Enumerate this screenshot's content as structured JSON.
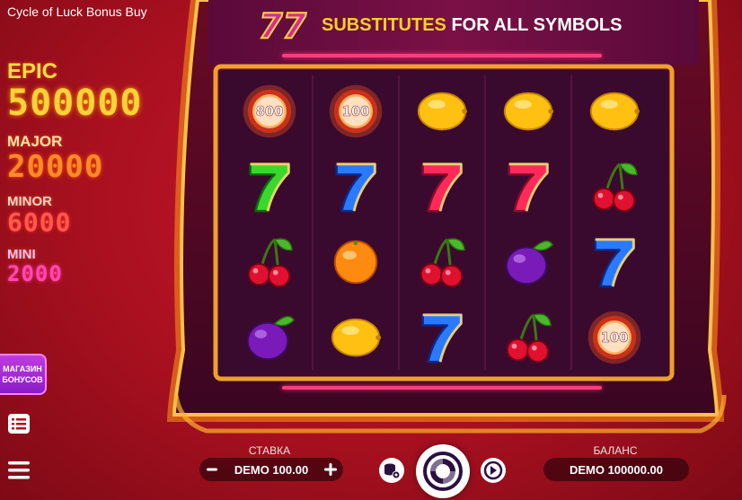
{
  "game_title": "Cycle of Luck Bonus Buy",
  "banner": {
    "highlight": "SUBSTITUTES",
    "rest": " FOR ALL SYMBOLS",
    "wild_symbol": "77"
  },
  "jackpots": {
    "epic": {
      "label": "EPIC",
      "value": "500000"
    },
    "major": {
      "label": "MAJOR",
      "value": "20000"
    },
    "minor": {
      "label": "MINOR",
      "value": "6000"
    },
    "mini": {
      "label": "MINI",
      "value": "2000"
    }
  },
  "bonus_shop": {
    "line1": "МАГАЗИН",
    "line2": "БОНУСОВ"
  },
  "grid": [
    [
      {
        "type": "coin",
        "value": "800"
      },
      {
        "type": "seven-green"
      },
      {
        "type": "cherry"
      },
      {
        "type": "plum"
      }
    ],
    [
      {
        "type": "coin",
        "value": "100"
      },
      {
        "type": "seven-blue"
      },
      {
        "type": "orange"
      },
      {
        "type": "lemon"
      }
    ],
    [
      {
        "type": "lemon"
      },
      {
        "type": "seven-red"
      },
      {
        "type": "cherry"
      },
      {
        "type": "seven-blue"
      }
    ],
    [
      {
        "type": "lemon"
      },
      {
        "type": "seven-red"
      },
      {
        "type": "plum"
      },
      {
        "type": "cherry"
      }
    ],
    [
      {
        "type": "lemon"
      },
      {
        "type": "cherry"
      },
      {
        "type": "seven-blue"
      },
      {
        "type": "coin",
        "value": "100"
      }
    ]
  ],
  "bet": {
    "label": "СТАВКА",
    "value": "DEMO 100.00"
  },
  "balance": {
    "label": "БАЛАНС",
    "value": "DEMO 100000.00"
  },
  "icons": {
    "minus": "minus-icon",
    "plus": "plus-icon",
    "autoplay": "autoplay-settings-icon",
    "spin": "spin-icon",
    "turbo": "turbo-icon",
    "paytable": "list-icon",
    "menu": "hamburger-icon"
  },
  "colors": {
    "background": "#b3121f",
    "frame_glow": "#ffb02e",
    "reel_bg": "#3a0a2e",
    "accent_yellow": "#ffcf2a",
    "bonus_purple": "#b02ed8"
  }
}
